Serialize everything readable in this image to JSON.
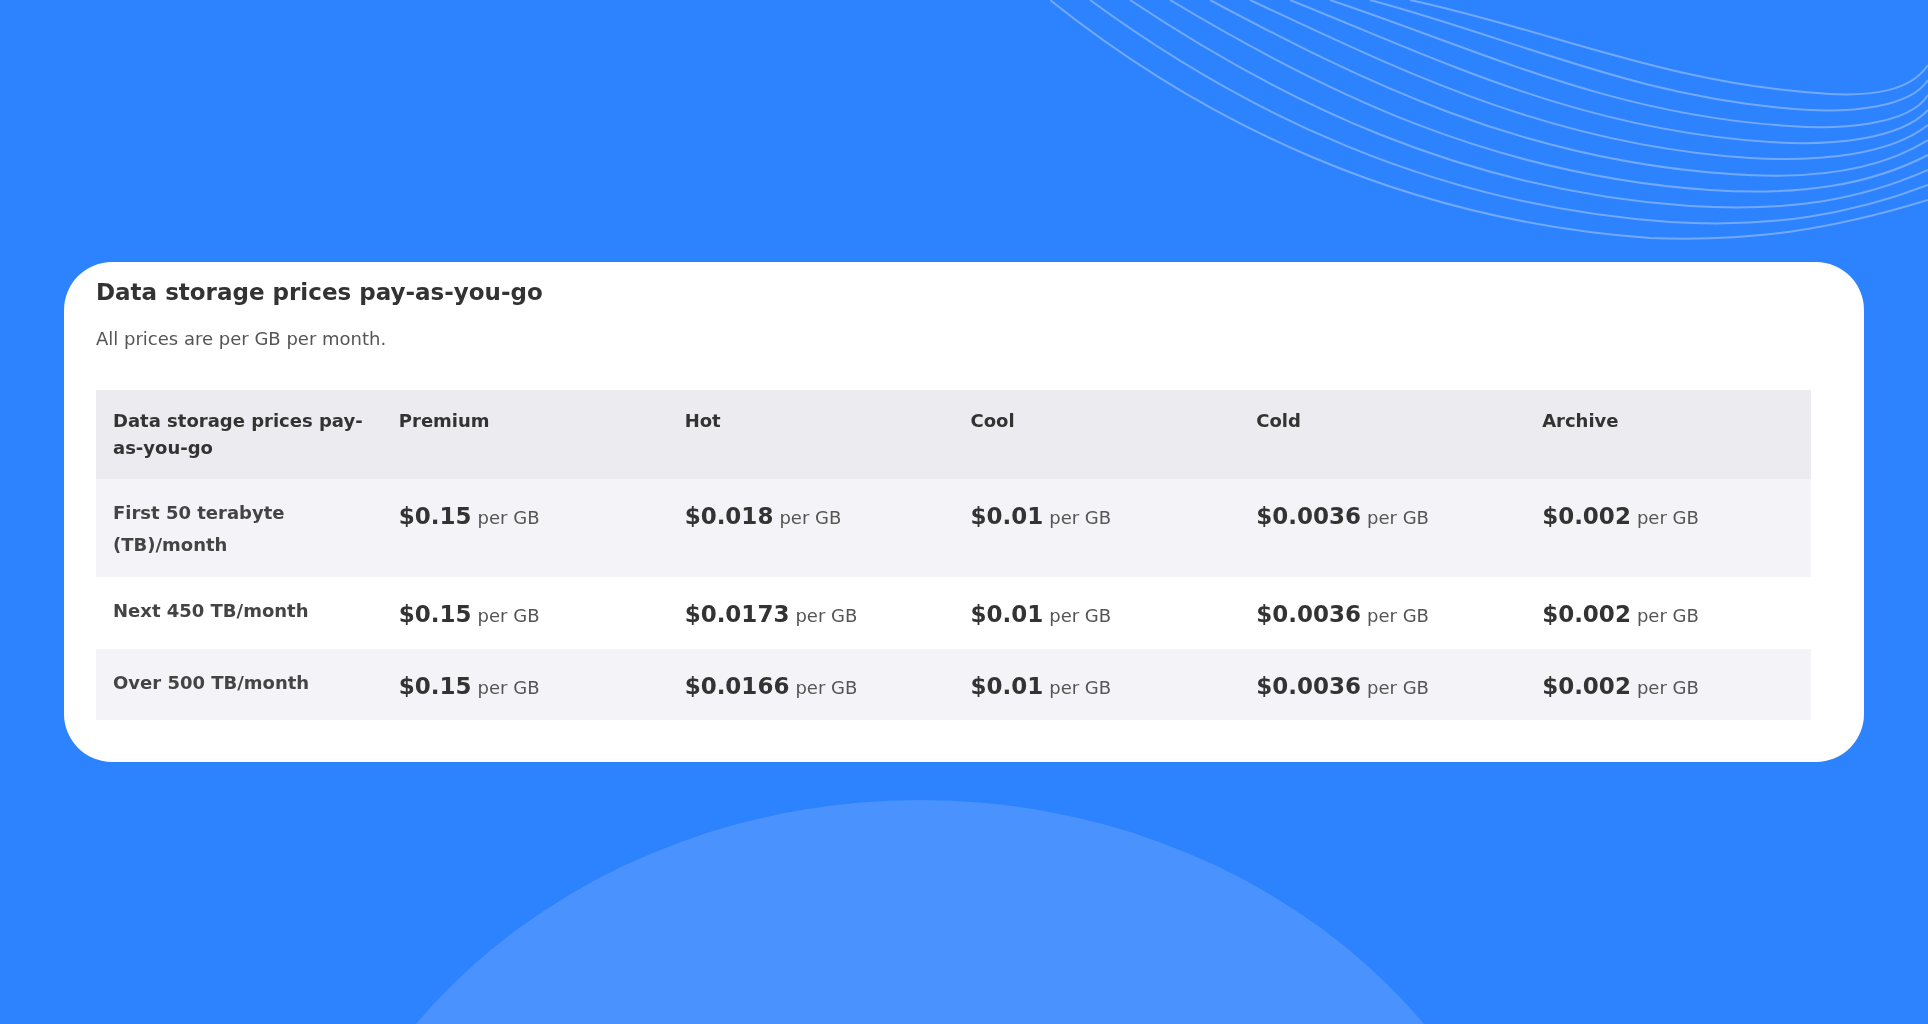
{
  "card": {
    "title": "Data storage prices pay-as-you-go",
    "subtitle": "All prices are per GB per month."
  },
  "table": {
    "columns": [
      "Data storage prices pay-as-you-go",
      "Premium",
      "Hot",
      "Cool",
      "Cold",
      "Archive"
    ],
    "rows": [
      {
        "label": "First 50 terabyte (TB)/month",
        "prices": [
          {
            "amount": "$0.15",
            "unit": "per GB"
          },
          {
            "amount": "$0.018",
            "unit": "per GB"
          },
          {
            "amount": "$0.01",
            "unit": "per GB"
          },
          {
            "amount": "$0.0036",
            "unit": "per GB"
          },
          {
            "amount": "$0.002",
            "unit": "per GB"
          }
        ]
      },
      {
        "label": "Next 450 TB/month",
        "prices": [
          {
            "amount": "$0.15",
            "unit": "per GB"
          },
          {
            "amount": "$0.0173",
            "unit": "per GB"
          },
          {
            "amount": "$0.01",
            "unit": "per GB"
          },
          {
            "amount": "$0.0036",
            "unit": "per GB"
          },
          {
            "amount": "$0.002",
            "unit": "per GB"
          }
        ]
      },
      {
        "label": "Over 500 TB/month",
        "prices": [
          {
            "amount": "$0.15",
            "unit": "per GB"
          },
          {
            "amount": "$0.0166",
            "unit": "per GB"
          },
          {
            "amount": "$0.01",
            "unit": "per GB"
          },
          {
            "amount": "$0.0036",
            "unit": "per GB"
          },
          {
            "amount": "$0.002",
            "unit": "per GB"
          }
        ]
      }
    ]
  }
}
